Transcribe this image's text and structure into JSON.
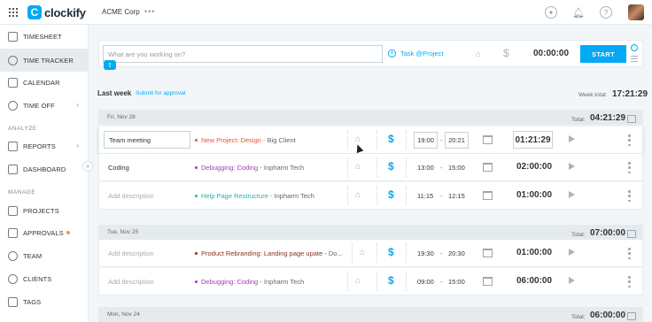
{
  "header": {
    "logo_text": "clockify",
    "logo_mark": "C",
    "workspace": "ACME Corp",
    "workspace_more": "•••",
    "icons": [
      "gift-icon",
      "bell-icon",
      "help-icon"
    ]
  },
  "sidebar": {
    "items": [
      {
        "label": "TIMESHEET",
        "icon": "timesheet-icon"
      },
      {
        "label": "TIME TRACKER",
        "icon": "clock-icon",
        "active": true
      },
      {
        "label": "CALENDAR",
        "icon": "calendar-icon"
      },
      {
        "label": "TIME OFF",
        "icon": "time-off-icon"
      },
      {
        "label": "REPORTS",
        "icon": "reports-icon"
      },
      {
        "label": "DASHBOARD",
        "icon": "dashboard-icon"
      },
      {
        "label": "PROJECTS",
        "icon": "projects-icon"
      },
      {
        "label": "APPROVALS",
        "icon": "approvals-icon"
      },
      {
        "label": "TEAM",
        "icon": "team-icon"
      },
      {
        "label": "CLIENTS",
        "icon": "clients-icon"
      },
      {
        "label": "TAGS",
        "icon": "tags-icon"
      }
    ],
    "sections": {
      "analyze": "ANALYZE",
      "manage": "MANAGE"
    }
  },
  "tracker": {
    "placeholder": "What are you working on?",
    "task_project": "Task @Project",
    "time": "00:00:00",
    "start_label": "START"
  },
  "week": {
    "label": "Last week",
    "submit_label": "Submit for approval",
    "total_label": "Week total:",
    "total": "17:21:29"
  },
  "days": [
    {
      "date": "Fri, Nov 28",
      "total_label": "Total:",
      "total": "04:21:29",
      "entries": [
        {
          "description": "Team meeting",
          "project": "New Project: Design",
          "separator": " - ",
          "client": "Big Client",
          "project_color": "#e8553a",
          "start": "19:00",
          "dash": "-",
          "end": "20:21",
          "duration": "01:21:29"
        },
        {
          "description": "Coding",
          "project": "Debugging: Coding",
          "separator": " - ",
          "client": "Inpharm Tech",
          "project_color": "#9b3fb5",
          "start": "13:00",
          "dash": "-",
          "end": "15:00",
          "duration": "02:00:00"
        },
        {
          "description": "Add description",
          "project": "Help Page Restructure",
          "separator": " - ",
          "client": "Inpharm Tech",
          "project_color": "#26b3a3",
          "start": "11:15",
          "dash": "-",
          "end": "12:15",
          "duration": "01:00:00"
        }
      ]
    },
    {
      "date": "Tue, Nov 25",
      "total_label": "Total:",
      "total": "07:00:00",
      "entries": [
        {
          "description": "Add description",
          "project": "Product Rebranding: Landing page upate",
          "separator": " - ",
          "client": "Do...",
          "project_color": "#8a2f1e",
          "start": "19:30",
          "dash": "-",
          "end": "20:30",
          "duration": "01:00:00"
        },
        {
          "description": "Add description",
          "project": "Debugging: Coding",
          "separator": " - ",
          "client": "Inpharm Tech",
          "project_color": "#9b3fb5",
          "start": "09:00",
          "dash": "-",
          "end": "15:00",
          "duration": "06:00:00"
        }
      ]
    },
    {
      "date": "Mon, Nov 24",
      "total_label": "Total:",
      "total": "06:00:00",
      "entries": []
    }
  ]
}
